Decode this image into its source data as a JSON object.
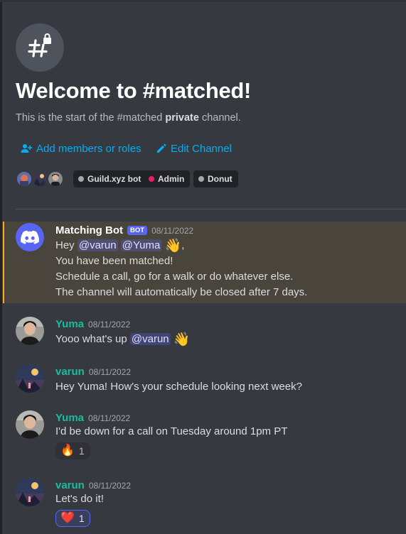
{
  "channel": {
    "icon": "locked-hash-icon",
    "welcome_title": "Welcome to #matched!",
    "sub_prefix": "This is the start of the #matched ",
    "sub_bold": "private",
    "sub_suffix": " channel."
  },
  "actions": {
    "add_members": "Add members or roles",
    "edit_channel": "Edit Channel"
  },
  "roles": [
    {
      "label": "Guild.xyz bot",
      "color": "#a3a6aa"
    },
    {
      "label": "Admin",
      "color": "#e91e63"
    },
    {
      "label": "Donut",
      "color": "#a3a6aa"
    }
  ],
  "messages": [
    {
      "author": "Matching Bot",
      "author_color": "#ffffff",
      "tag": "BOT",
      "time": "08/11/2022",
      "mention1": "@varun",
      "mention2": "@Yuma",
      "emoji": "👋",
      "trailing": ",",
      "lines": [
        "You have been matched!",
        "Schedule a call, go for a walk or do whatever else.",
        "The channel will automatically be closed after 7 days."
      ]
    },
    {
      "author": "Yuma",
      "author_color": "#1abc9c",
      "time": "08/11/2022",
      "text_prefix": "Yooo what's up ",
      "mention": "@varun",
      "emoji": "👋"
    },
    {
      "author": "varun",
      "author_color": "#1abc9c",
      "time": "08/11/2022",
      "text": "Hey Yuma! How's your schedule looking next week?"
    },
    {
      "author": "Yuma",
      "author_color": "#1abc9c",
      "time": "08/11/2022",
      "text": "I'd be down for a call on Tuesday around 1pm PT",
      "reaction": {
        "emoji": "🔥",
        "count": "1"
      }
    },
    {
      "author": "varun",
      "author_color": "#1abc9c",
      "time": "08/11/2022",
      "text": "Let's do it!",
      "reaction": {
        "emoji": "❤️",
        "count": "1"
      }
    }
  ],
  "mention_prefix_hey": "Hey "
}
